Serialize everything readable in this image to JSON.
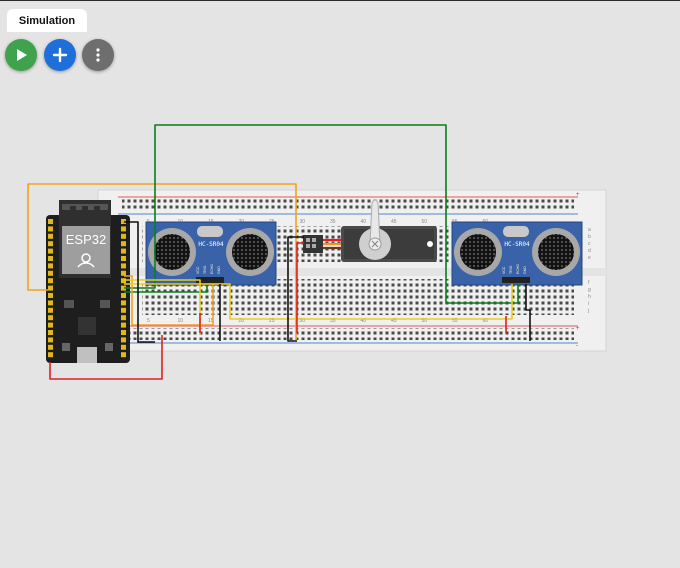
{
  "tabs": {
    "active_label": "Simulation"
  },
  "toolbar": {
    "play_icon": "play-icon",
    "add_icon": "plus-icon",
    "more_icon": "more-vertical-icon",
    "play_color": "#3fa34d",
    "add_color": "#1e6fd9",
    "more_color": "#6e6e6e"
  },
  "circuit": {
    "mcu_label": "ESP32",
    "sensor_left": {
      "label": "HC-SR04",
      "pins": [
        "VCC",
        "TRIG",
        "ECHO",
        "GND"
      ]
    },
    "sensor_right": {
      "label": "HC-SR04",
      "pins": [
        "VCC",
        "TRIG",
        "ECHO",
        "GND"
      ]
    },
    "breadboard_top_numbers": [
      "5",
      "10",
      "15",
      "20",
      "25",
      "30",
      "35",
      "40",
      "45",
      "50",
      "55",
      "60"
    ],
    "breadboard_bottom_numbers": [
      "5",
      "10",
      "15",
      "20",
      "25",
      "30",
      "35",
      "40",
      "45",
      "50",
      "55",
      "60"
    ],
    "row_letters_top": [
      "a",
      "b",
      "c",
      "d",
      "e"
    ],
    "row_letters_bottom": [
      "f",
      "g",
      "h",
      "i",
      "j"
    ],
    "wire_colors": {
      "orange": "#f2a21c",
      "green": "#0b7d1a",
      "red": "#e02020",
      "black": "#111111",
      "yellow": "#e8cf1a"
    }
  }
}
